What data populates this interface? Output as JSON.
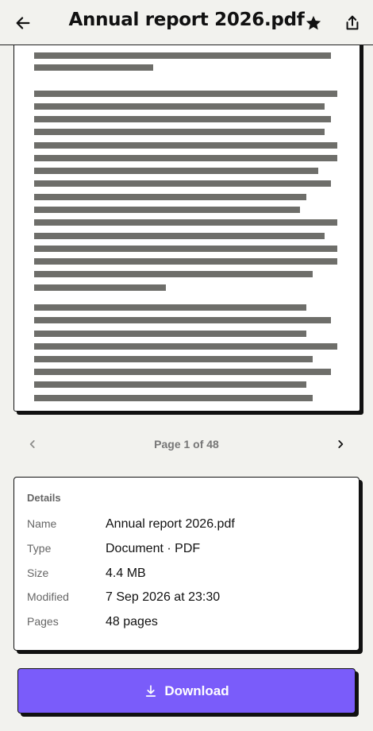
{
  "header": {
    "title": "Annual report 2026.pdf",
    "back_icon": "arrow-left-icon",
    "favorite_icon": "star-icon",
    "share_icon": "share-icon"
  },
  "pager": {
    "label": "Page 1 of 48",
    "current_page": 1,
    "total_pages": 48
  },
  "details": {
    "heading": "Details",
    "rows": [
      {
        "key": "Name",
        "value": "Annual report 2026.pdf"
      },
      {
        "key": "Type",
        "value": "Document · PDF"
      },
      {
        "key": "Size",
        "value": "4.4 MB"
      },
      {
        "key": "Modified",
        "value": "7 Sep 2026 at 23:30"
      },
      {
        "key": "Pages",
        "value": "48 pages"
      }
    ]
  },
  "download": {
    "label": "Download",
    "icon": "download-icon"
  },
  "colors": {
    "accent": "#7a5cfa",
    "background": "#f2f2ee",
    "text_placeholder": "#6e6e6a"
  }
}
